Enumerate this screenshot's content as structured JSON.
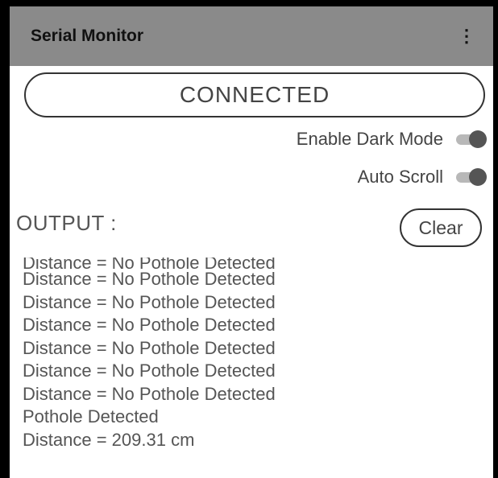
{
  "appbar": {
    "title": "Serial Monitor",
    "menu_icon": "more-vert-icon"
  },
  "status": {
    "label": "CONNECTED"
  },
  "settings": {
    "dark_mode_label": "Enable Dark Mode",
    "dark_mode_on": true,
    "auto_scroll_label": "Auto Scroll",
    "auto_scroll_on": true
  },
  "output": {
    "label": "OUTPUT :",
    "clear_label": "Clear",
    "partial_line": "Distance = No Pothole Detected",
    "lines": [
      "Distance = No Pothole Detected",
      "Distance = No Pothole Detected",
      "Distance = No Pothole Detected",
      "Distance = No Pothole Detected",
      "Distance = No Pothole Detected",
      "Distance = No Pothole Detected",
      "Pothole Detected",
      "Distance = 209.31 cm"
    ]
  }
}
